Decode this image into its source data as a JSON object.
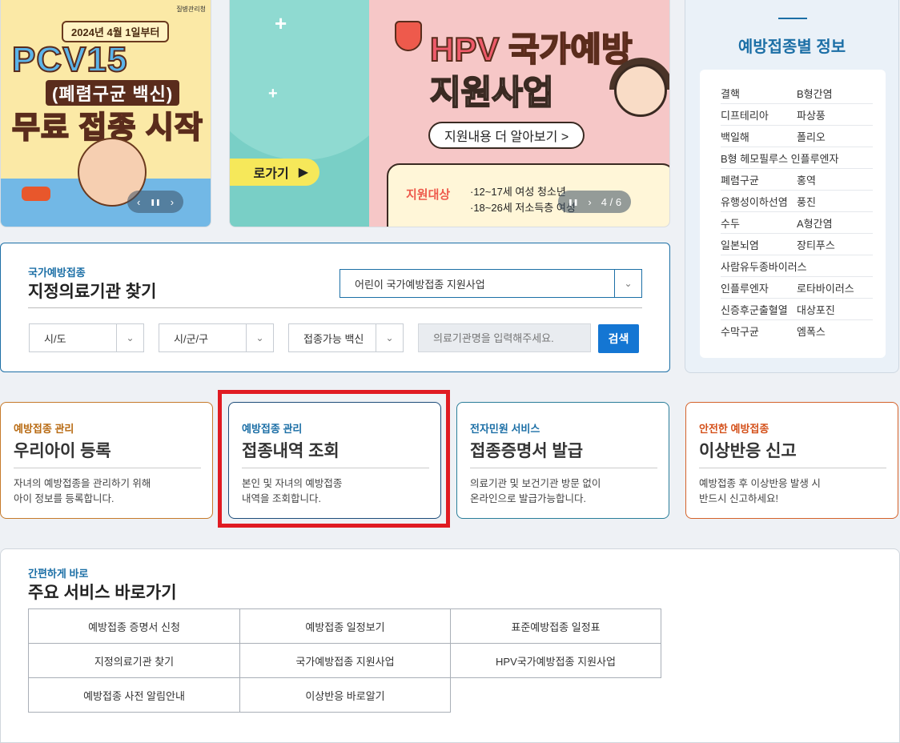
{
  "banner1": {
    "agency": "질병관리청",
    "date": "2024년 4월 1일부터",
    "line1": "PCV15",
    "line2": "(폐렴구균 백신)",
    "line3": "무료 접종 시작"
  },
  "banner2": {
    "title": "HPV 국가예방",
    "title2": "지원사업",
    "more_label": "지원내용 더 알아보기 >",
    "shortcut_label": "로가기",
    "target_label": "지원대상",
    "target_line1": "·12~17세 여성 청소년",
    "target_line2": "·18~26세 저소득층 여성",
    "counter": "4 / 6"
  },
  "side": {
    "title": "예방접종별 정보",
    "rows": [
      [
        "결핵",
        "B형간염"
      ],
      [
        "디프테리아",
        "파상풍"
      ],
      [
        "백일해",
        "폴리오"
      ],
      [
        "B형 헤모필루스 인플루엔자",
        ""
      ],
      [
        "폐렴구균",
        "홍역"
      ],
      [
        "유행성이하선염",
        "풍진"
      ],
      [
        "수두",
        "A형간염"
      ],
      [
        "일본뇌염",
        "장티푸스"
      ],
      [
        "사람유두종바이러스",
        ""
      ],
      [
        "인플루엔자",
        "로타바이러스"
      ],
      [
        "신증후군출혈열",
        "대상포진"
      ],
      [
        "수막구균",
        "엠폭스"
      ]
    ]
  },
  "finder": {
    "subtitle": "국가예방접종",
    "title": "지정의료기관 찾기",
    "program": "어린이 국가예방접종 지원사업",
    "sido": "시/도",
    "sigungu": "시/군/구",
    "vaccine": "접종가능 백신",
    "search_placeholder": "의료기관명을 입력해주세요.",
    "search_btn": "검색"
  },
  "cards": [
    {
      "category": "예방접종 관리",
      "title": "우리아이 등록",
      "desc1": "자녀의 예방접종을 관리하기 위해",
      "desc2": "아이 정보를 등록합니다."
    },
    {
      "category": "예방접종 관리",
      "title": "접종내역 조회",
      "desc1": "본인 및 자녀의 예방접종",
      "desc2": "내역을 조회합니다."
    },
    {
      "category": "전자민원 서비스",
      "title": "접종증명서 발급",
      "desc1": "의료기관 및 보건기관 방문 없이",
      "desc2": "온라인으로 발급가능합니다."
    },
    {
      "category": "안전한 예방접종",
      "title": "이상반응 신고",
      "desc1": "예방접종 후 이상반응 발생 시",
      "desc2": "반드시 신고하세요!"
    }
  ],
  "quick": {
    "subtitle": "간편하게 바로",
    "title": "주요 서비스 바로가기",
    "links": [
      "예방접종 증명서 신청",
      "예방접종 일정보기",
      "표준예방접종 일정표",
      "지정의료기관 찾기",
      "국가예방접종 지원사업",
      "HPV국가예방접종 지원사업",
      "예방접종 사전 알림안내",
      "이상반응 바로알기"
    ]
  },
  "controls": {
    "prev": "‹",
    "pause": "❚❚",
    "next": "›",
    "dropdown": "⌄"
  },
  "colors": {
    "primary": "#1c6fa6",
    "search_button": "#1476d3",
    "highlight": "#e01b22"
  }
}
